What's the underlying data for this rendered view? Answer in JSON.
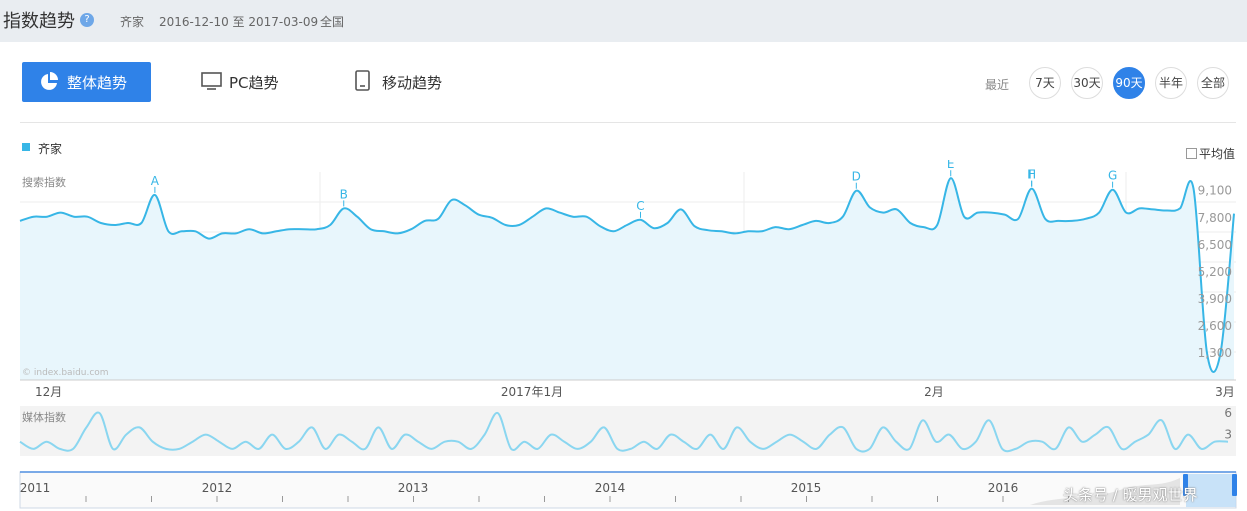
{
  "header": {
    "title": "指数趋势",
    "help_icon": "?",
    "keyword": "齐家",
    "date_range": "2016-12-10 至 2017-03-09",
    "region": "全国"
  },
  "tabs": {
    "overall": "整体趋势",
    "pc": "PC趋势",
    "mobile": "移动趋势"
  },
  "period": {
    "label": "最近",
    "options": [
      "7天",
      "30天",
      "90天",
      "半年",
      "全部"
    ],
    "active": "90天"
  },
  "legend": {
    "series": "齐家",
    "avg_label": "平均值"
  },
  "colors": {
    "accent": "#2f82e8",
    "series": "#37b6e6",
    "media": "#8ad6f0"
  },
  "chart_data": [
    {
      "type": "area",
      "title": "",
      "ylabel": "搜索指数",
      "ylim": [
        0,
        10000
      ],
      "y_ticks": [
        "9,100",
        "7,800",
        "6,500",
        "5,200",
        "3,900",
        "2,600",
        "1,300"
      ],
      "x_tick_labels": [
        "12月",
        "2017年1月",
        "2月",
        "3月"
      ],
      "source_note": "© index.baidu.com",
      "grid": true,
      "series": [
        {
          "name": "齐家",
          "values": [
            7650,
            7850,
            7850,
            8050,
            7850,
            7850,
            7550,
            7450,
            7550,
            7550,
            8900,
            7150,
            7150,
            7150,
            6800,
            7050,
            7050,
            7250,
            7050,
            7150,
            7250,
            7250,
            7250,
            7450,
            8250,
            7850,
            7250,
            7150,
            7050,
            7250,
            7650,
            7750,
            8650,
            8400,
            7950,
            7800,
            7450,
            7450,
            7850,
            8250,
            8050,
            7850,
            7850,
            7400,
            7150,
            7450,
            7700,
            7300,
            7550,
            8200,
            7400,
            7200,
            7150,
            7050,
            7150,
            7150,
            7350,
            7250,
            7450,
            7650,
            7550,
            7850,
            9100,
            8300,
            8050,
            8200,
            7550,
            7350,
            7450,
            9700,
            7850,
            8050,
            8050,
            7950,
            7750,
            9200,
            7750,
            7650,
            7650,
            7750,
            8050,
            9150,
            8050,
            8250,
            8200,
            8150,
            8250,
            9200,
            1300,
            1300,
            8000
          ]
        }
      ],
      "annotations": [
        {
          "label": "A",
          "value": 8900
        },
        {
          "label": "B",
          "value": 8250
        },
        {
          "label": "C",
          "value": 7700
        },
        {
          "label": "D",
          "value": 9100
        },
        {
          "label": "E",
          "value": 9700
        },
        {
          "label": "F",
          "value": 9200
        },
        {
          "label": "G",
          "value": 9150
        },
        {
          "label": "H",
          "value": 9200
        }
      ]
    },
    {
      "type": "area",
      "title": "",
      "ylabel": "媒体指数",
      "ylim": [
        0,
        7
      ],
      "y_ticks": [
        "6",
        "3"
      ],
      "series": [
        {
          "values": [
            2,
            1,
            2,
            1,
            1,
            4,
            6,
            1,
            3,
            4,
            2,
            1,
            1,
            2,
            3,
            2,
            1,
            2,
            1,
            3,
            1,
            2,
            4,
            1,
            3,
            2,
            1,
            4,
            1,
            3,
            2,
            1,
            2,
            2,
            1,
            3,
            6,
            1,
            2,
            1,
            3,
            2,
            1,
            2,
            4,
            1,
            1,
            2,
            1,
            3,
            2,
            1,
            3,
            1,
            4,
            2,
            1,
            2,
            3,
            2,
            1,
            3,
            4,
            1,
            1,
            4,
            2,
            1,
            5,
            2,
            3,
            1,
            2,
            5,
            1,
            1,
            2,
            2,
            1,
            4,
            2,
            3,
            4,
            1,
            2,
            3,
            5,
            1,
            3,
            1,
            2,
            2
          ]
        }
      ]
    },
    {
      "type": "area",
      "title": "",
      "x_tick_labels": [
        "2011",
        "2012",
        "2013",
        "2014",
        "2015",
        "2016"
      ]
    }
  ],
  "watermark": "头条号 / 暖男观世界"
}
